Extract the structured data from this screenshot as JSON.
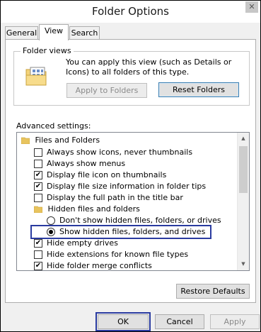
{
  "window": {
    "title": "Folder Options",
    "close_glyph": "✕"
  },
  "tabs": [
    {
      "label": "General",
      "active": false
    },
    {
      "label": "View",
      "active": true
    },
    {
      "label": "Search",
      "active": false
    }
  ],
  "folder_views": {
    "legend": "Folder views",
    "description": "You can apply this view (such as Details or Icons) to all folders of this type.",
    "apply_button": "Apply to Folders",
    "reset_button": "Reset Folders",
    "icon": "folder-views-icon"
  },
  "advanced": {
    "label": "Advanced settings:",
    "items": [
      {
        "type": "folder",
        "label": "Files and Folders"
      },
      {
        "type": "checkbox",
        "label": "Always show icons, never thumbnails",
        "checked": false
      },
      {
        "type": "checkbox",
        "label": "Always show menus",
        "checked": false
      },
      {
        "type": "checkbox",
        "label": "Display file icon on thumbnails",
        "checked": true
      },
      {
        "type": "checkbox",
        "label": "Display file size information in folder tips",
        "checked": true
      },
      {
        "type": "checkbox",
        "label": "Display the full path in the title bar",
        "checked": false
      },
      {
        "type": "folder",
        "label": "Hidden files and folders"
      },
      {
        "type": "radio",
        "label": "Don't show hidden files, folders, or drives",
        "checked": false
      },
      {
        "type": "radio",
        "label": "Show hidden files, folders, and drives",
        "checked": true
      },
      {
        "type": "checkbox",
        "label": "Hide empty drives",
        "checked": true
      },
      {
        "type": "checkbox",
        "label": "Hide extensions for known file types",
        "checked": false
      },
      {
        "type": "checkbox",
        "label": "Hide folder merge conflicts",
        "checked": true
      }
    ]
  },
  "restore_button": "Restore Defaults",
  "footer": {
    "ok": "OK",
    "cancel": "Cancel",
    "apply": "Apply"
  },
  "colors": {
    "highlight": "#2a3ba0",
    "folder": "#e8c45e"
  }
}
